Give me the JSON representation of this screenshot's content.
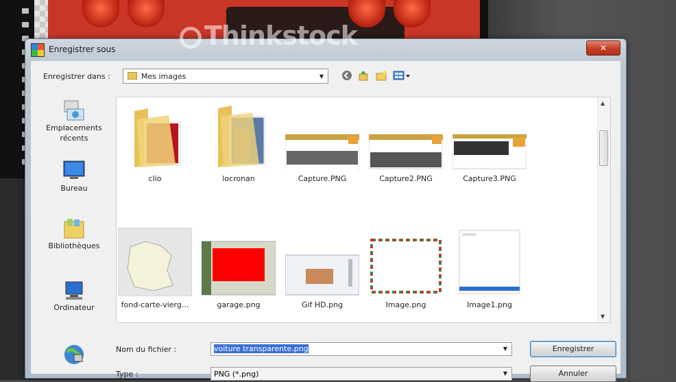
{
  "watermark": "Thinkstock",
  "dialog": {
    "title": "Enregistrer sous",
    "close_glyph": "✕",
    "save_in_label": "Enregistrer dans :",
    "location": "Mes images",
    "toolbar_icons": [
      "back-icon",
      "up-folder-icon",
      "new-folder-icon",
      "view-menu-icon"
    ]
  },
  "places": [
    {
      "label": "Emplacements récents",
      "icon": "recent-places-icon"
    },
    {
      "label": "Bureau",
      "icon": "desktop-icon"
    },
    {
      "label": "Bibliothèques",
      "icon": "libraries-icon"
    },
    {
      "label": "Ordinateur",
      "icon": "computer-icon"
    },
    {
      "label": "",
      "icon": "network-icon"
    }
  ],
  "files": [
    {
      "name": "clio",
      "kind": "folder"
    },
    {
      "name": "locronan",
      "kind": "folder"
    },
    {
      "name": "Capture.PNG",
      "kind": "image"
    },
    {
      "name": "Capture2.PNG",
      "kind": "image"
    },
    {
      "name": "Capture3.PNG",
      "kind": "image"
    },
    {
      "name": "fond-carte-vierg...",
      "kind": "image"
    },
    {
      "name": "garage.png",
      "kind": "image"
    },
    {
      "name": "Gif HD.png",
      "kind": "image"
    },
    {
      "name": "Image.png",
      "kind": "image"
    },
    {
      "name": "Image1.png",
      "kind": "image"
    }
  ],
  "form": {
    "filename_label": "Nom du fichier :",
    "filename_value": "voiture transparente.png",
    "type_label": "Type :",
    "type_value": "PNG (*.png)",
    "save_button": "Enregistrer",
    "cancel_button": "Annuler"
  },
  "colors": {
    "accent": "#c93628",
    "selection": "#3a6fd8"
  }
}
